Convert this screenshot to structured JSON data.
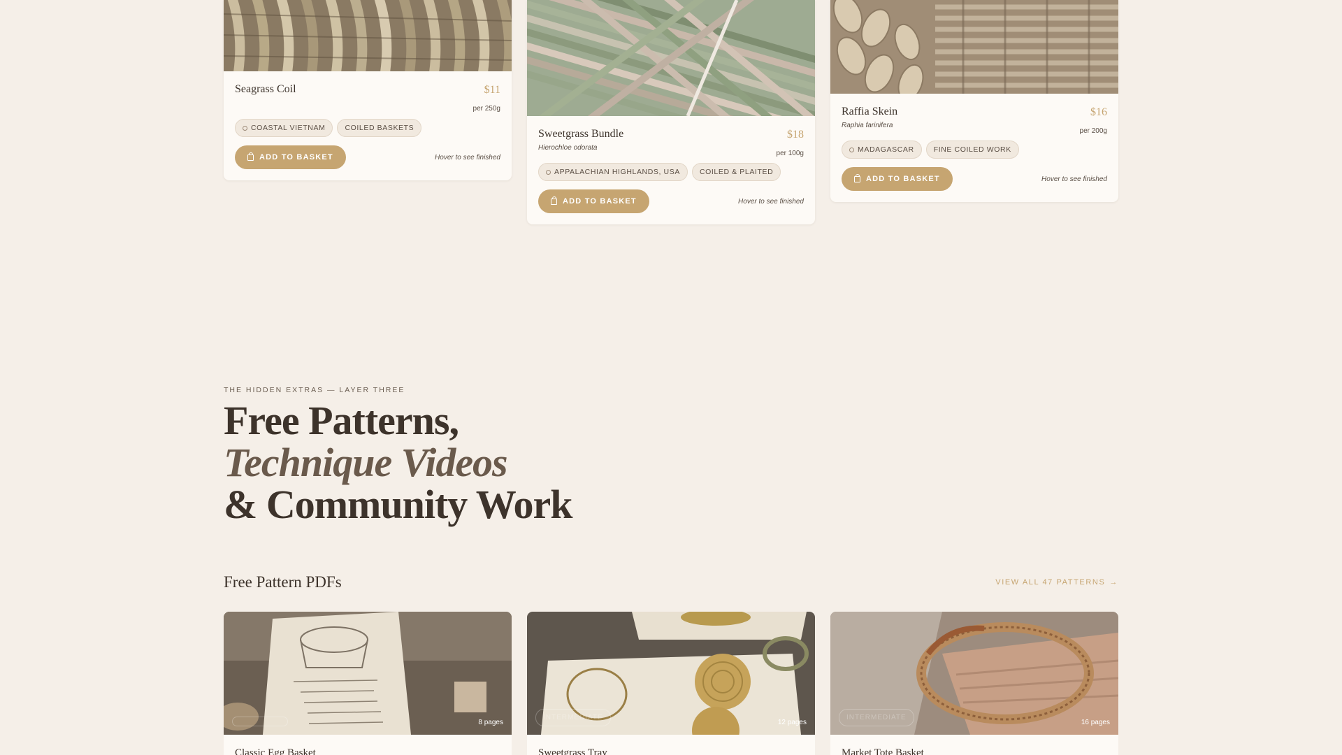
{
  "products": [
    {
      "name": "Seagrass Coil",
      "latin": "",
      "price": "$11",
      "unit": "per 250g",
      "tags": [
        "COASTAL VIETNAM",
        "COILED BASKETS"
      ],
      "button": "ADD TO BASKET",
      "hint": "Hover to see finished"
    },
    {
      "name": "Sweetgrass Bundle",
      "latin": "Hierochloe odorata",
      "price": "$18",
      "unit": "per 100g",
      "tags": [
        "APPALACHIAN HIGHLANDS, USA",
        "COILED & PLAITED"
      ],
      "button": "ADD TO BASKET",
      "hint": "Hover to see finished"
    },
    {
      "name": "Raffia Skein",
      "latin": "Raphia farinifera",
      "price": "$16",
      "unit": "per 200g",
      "tags": [
        "MADAGASCAR",
        "FINE COILED WORK"
      ],
      "button": "ADD TO BASKET",
      "hint": "Hover to see finished"
    }
  ],
  "section": {
    "eyebrow": "THE HIDDEN EXTRAS — LAYER THREE",
    "headline_line1": "Free Patterns,",
    "headline_line2": "Technique Videos",
    "headline_line3": "& Community Work"
  },
  "patterns": {
    "title": "Free Pattern PDFs",
    "view_all": "VIEW ALL 47 PATTERNS",
    "arrow": "→",
    "items": [
      {
        "level": "",
        "pages": "8 pages",
        "title": "Classic Egg Basket"
      },
      {
        "level": "INTERMEDIATE",
        "pages": "12 pages",
        "title": "Sweetgrass Tray"
      },
      {
        "level": "INTERMEDIATE",
        "pages": "16 pages",
        "title": "Market Tote Basket"
      }
    ]
  },
  "colors": {
    "page_bg": "#f5efe8",
    "card_bg": "#fdfaf6",
    "accent": "#c6a571",
    "text": "#3d332b"
  }
}
